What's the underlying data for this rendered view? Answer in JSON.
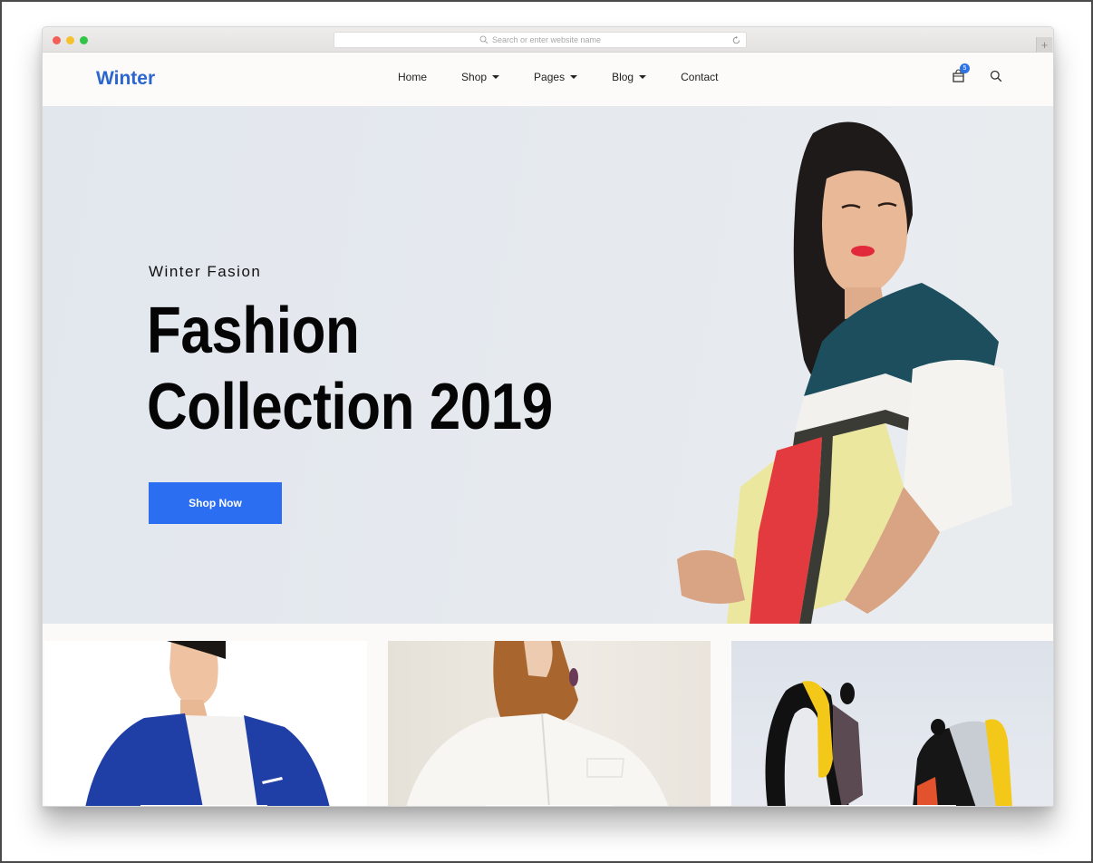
{
  "browser": {
    "address_placeholder": "Search or enter website name",
    "new_tab_symbol": "+",
    "window_controls": [
      "close",
      "minimize",
      "maximize"
    ],
    "icons": [
      "search-icon",
      "reload-icon",
      "plus-icon"
    ]
  },
  "header": {
    "logo": "Winter",
    "nav": [
      {
        "label": "Home",
        "has_dropdown": false
      },
      {
        "label": "Shop",
        "has_dropdown": true
      },
      {
        "label": "Pages",
        "has_dropdown": true
      },
      {
        "label": "Blog",
        "has_dropdown": true
      },
      {
        "label": "Contact",
        "has_dropdown": false
      }
    ],
    "cart_count": "5",
    "icons": [
      "cart-icon",
      "search-icon"
    ]
  },
  "hero": {
    "eyebrow": "Winter Fasion",
    "title_line1": "Fashion",
    "title_line2": "Collection 2019",
    "cta_label": "Shop Now",
    "image": "woman-in-mesh-color-block-top"
  },
  "products": [
    {
      "image": "man-in-blue-blazer"
    },
    {
      "image": "woman-in-white-shirt"
    },
    {
      "image": "sneakers-yellow-black"
    }
  ],
  "colors": {
    "brand": "#2b66d0",
    "cta": "#2c6ef2",
    "badge": "#2d73e8",
    "hero_bg": "#e4e8ee",
    "text": "#050505"
  }
}
